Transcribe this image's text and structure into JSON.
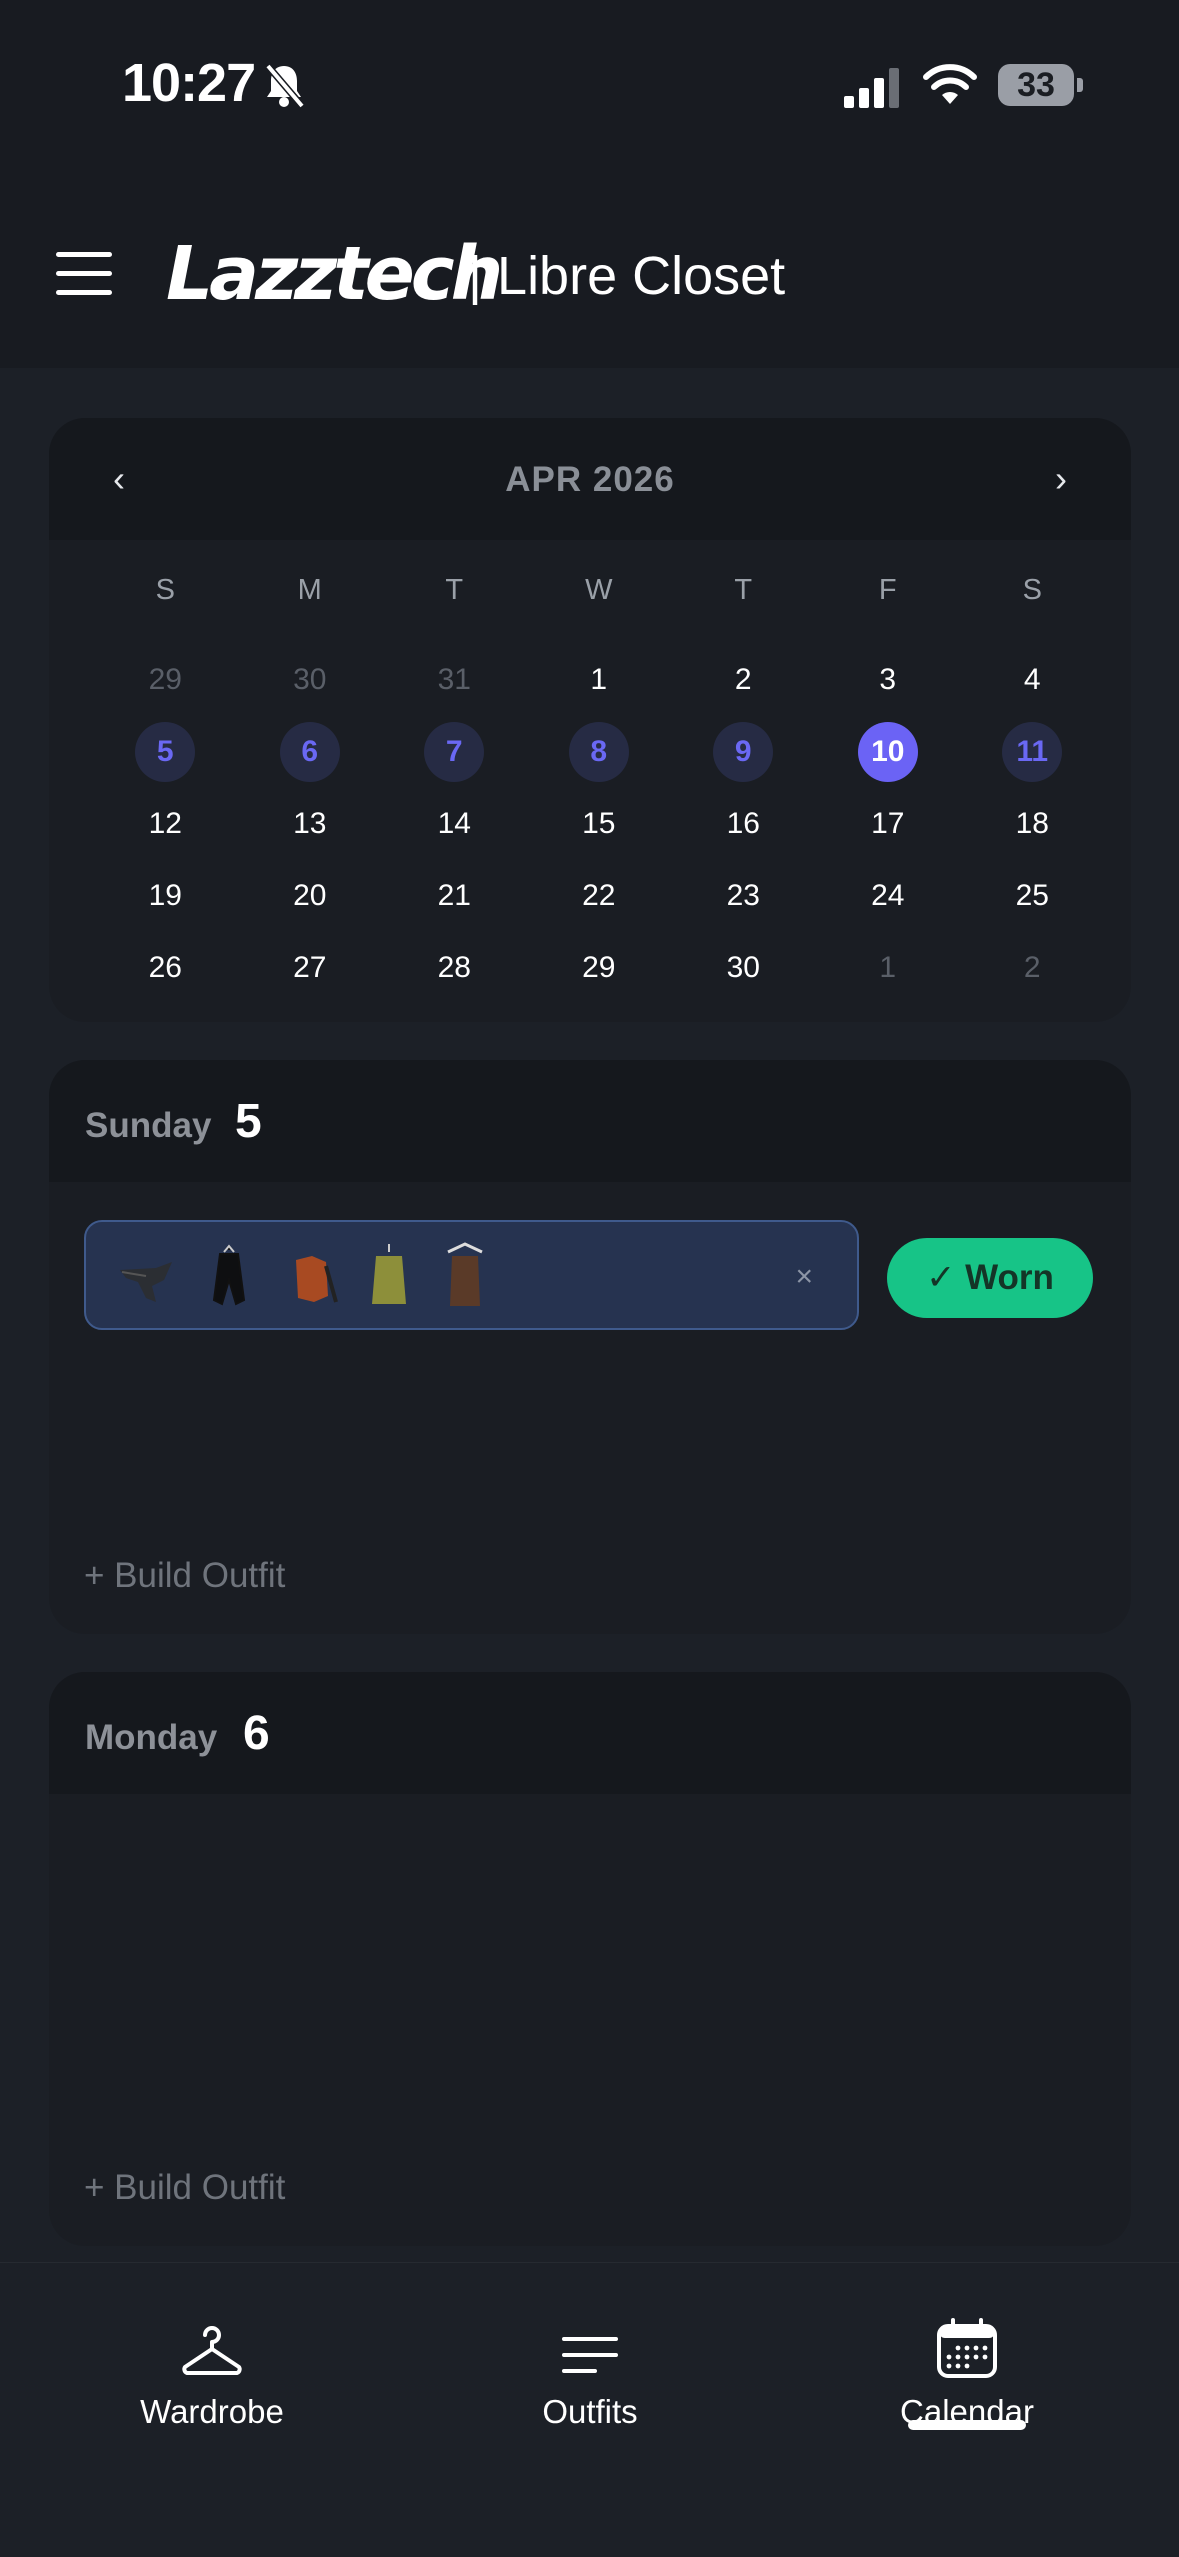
{
  "status": {
    "time": "10:27",
    "battery": "33"
  },
  "app": {
    "logo": "Lazztech",
    "title": "| Libre Closet"
  },
  "calendar": {
    "prev_label": "‹",
    "next_label": "›",
    "month_label": "APR 2026",
    "weekdays": [
      "S",
      "M",
      "T",
      "W",
      "T",
      "F",
      "S"
    ],
    "days": [
      {
        "n": "29",
        "s": "muted"
      },
      {
        "n": "30",
        "s": "muted"
      },
      {
        "n": "31",
        "s": "muted"
      },
      {
        "n": "1",
        "s": ""
      },
      {
        "n": "2",
        "s": ""
      },
      {
        "n": "3",
        "s": ""
      },
      {
        "n": "4",
        "s": ""
      },
      {
        "n": "5",
        "s": "week"
      },
      {
        "n": "6",
        "s": "week"
      },
      {
        "n": "7",
        "s": "week"
      },
      {
        "n": "8",
        "s": "week"
      },
      {
        "n": "9",
        "s": "week"
      },
      {
        "n": "10",
        "s": "today"
      },
      {
        "n": "11",
        "s": "week"
      },
      {
        "n": "12",
        "s": ""
      },
      {
        "n": "13",
        "s": ""
      },
      {
        "n": "14",
        "s": ""
      },
      {
        "n": "15",
        "s": ""
      },
      {
        "n": "16",
        "s": ""
      },
      {
        "n": "17",
        "s": ""
      },
      {
        "n": "18",
        "s": ""
      },
      {
        "n": "19",
        "s": ""
      },
      {
        "n": "20",
        "s": ""
      },
      {
        "n": "21",
        "s": ""
      },
      {
        "n": "22",
        "s": ""
      },
      {
        "n": "23",
        "s": ""
      },
      {
        "n": "24",
        "s": ""
      },
      {
        "n": "25",
        "s": ""
      },
      {
        "n": "26",
        "s": ""
      },
      {
        "n": "27",
        "s": ""
      },
      {
        "n": "28",
        "s": ""
      },
      {
        "n": "29",
        "s": ""
      },
      {
        "n": "30",
        "s": ""
      },
      {
        "n": "1",
        "s": "muted"
      },
      {
        "n": "2",
        "s": "muted"
      }
    ]
  },
  "sunday": {
    "day_name": "Sunday",
    "day_number": "5",
    "outfit_items": [
      "scarf",
      "black coat",
      "orange jacket",
      "olive sweater",
      "brown top"
    ],
    "remove_label": "×",
    "worn_label": "✓ Worn",
    "build_label": "+ Build Outfit"
  },
  "monday": {
    "day_name": "Monday",
    "day_number": "6",
    "build_label": "+ Build Outfit"
  },
  "tabs": [
    {
      "label": "Wardrobe",
      "icon": "hanger-icon"
    },
    {
      "label": "Outfits",
      "icon": "lines-icon"
    },
    {
      "label": "Calendar",
      "icon": "calendar-icon",
      "active": true
    }
  ],
  "colors": {
    "accent": "#6b63f5",
    "worn": "#17c487"
  }
}
